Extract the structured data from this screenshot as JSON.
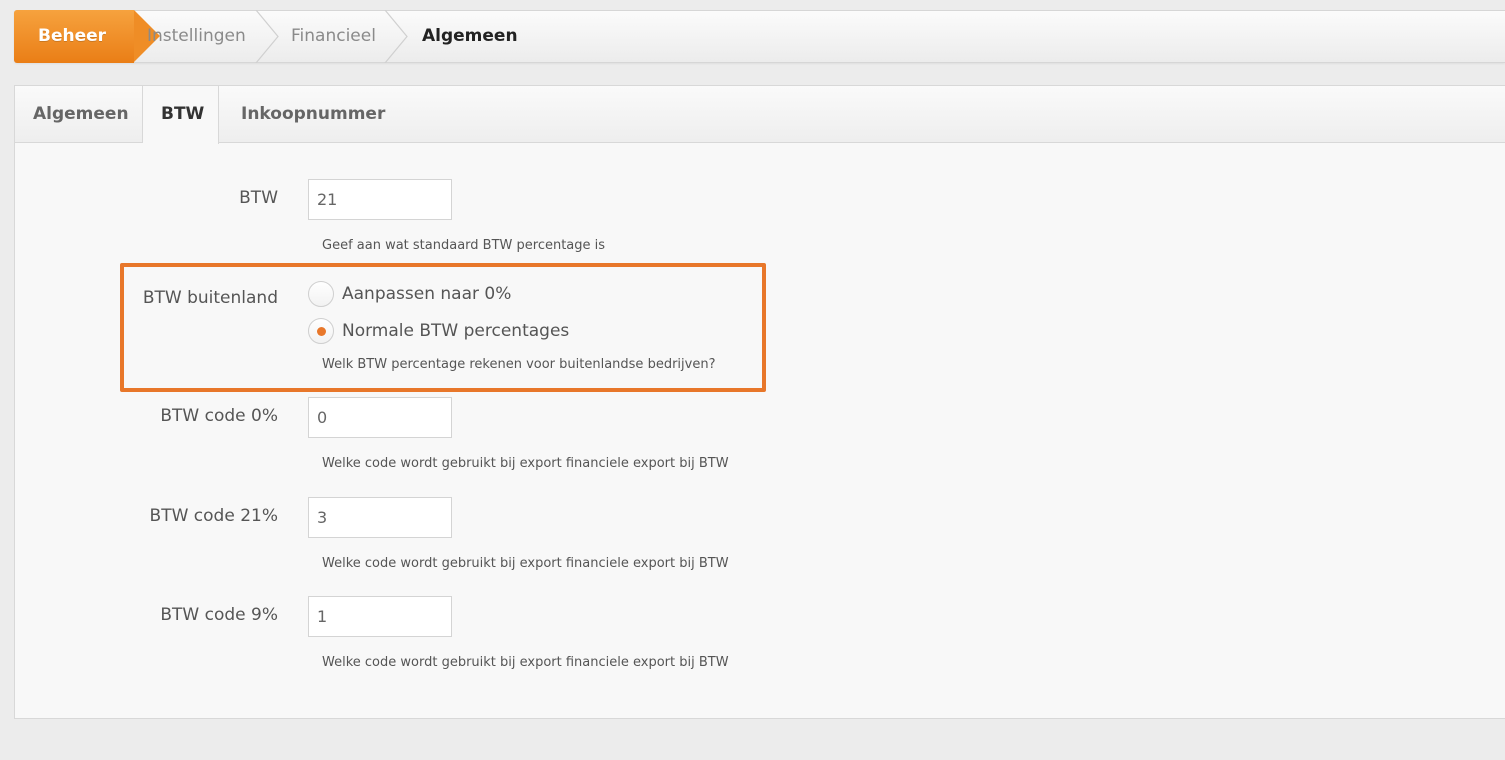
{
  "breadcrumb": {
    "items": [
      "Beheer",
      "Instellingen",
      "Financieel",
      "Algemeen"
    ]
  },
  "tabs": [
    "Algemeen",
    "BTW",
    "Inkoopnummer"
  ],
  "active_tab": "BTW",
  "form": {
    "btw": {
      "label": "BTW",
      "value": "21",
      "help": "Geef aan wat standaard BTW percentage is"
    },
    "btw_buitenland": {
      "label": "BTW buitenland",
      "options": [
        "Aanpassen naar 0%",
        "Normale BTW percentages"
      ],
      "selected": "Normale BTW percentages",
      "help": "Welk BTW percentage rekenen voor buitenlandse bedrijven?"
    },
    "btw_code_0": {
      "label": "BTW code 0%",
      "value": "0",
      "help": "Welke code wordt gebruikt bij export financiele export bij BTW"
    },
    "btw_code_21": {
      "label": "BTW code 21%",
      "value": "3",
      "help": "Welke code wordt gebruikt bij export financiele export bij BTW"
    },
    "btw_code_9": {
      "label": "BTW code 9%",
      "value": "1",
      "help": "Welke code wordt gebruikt bij export financiele export bij BTW"
    }
  },
  "colors": {
    "accent": "#e8772a",
    "highlight_border": "#e8772a"
  }
}
